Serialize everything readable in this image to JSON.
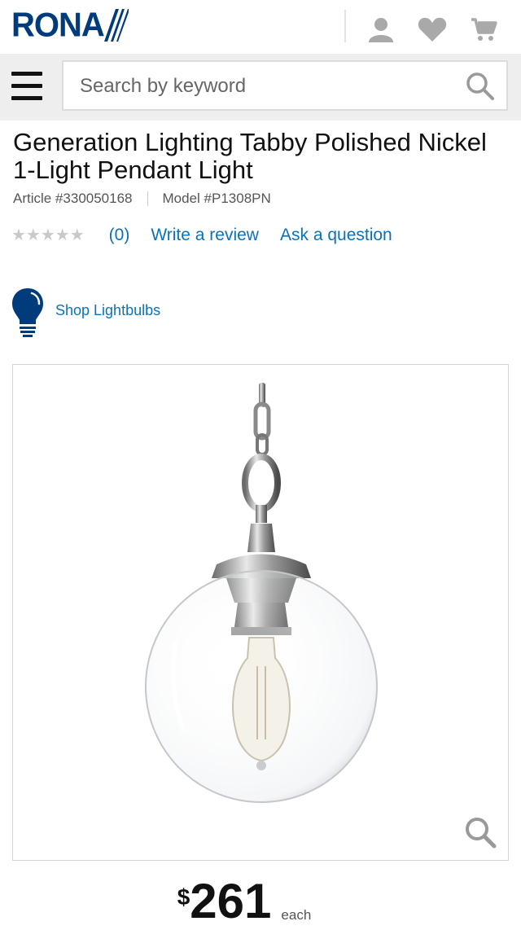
{
  "header": {
    "brand": "RONA",
    "brand_color": "#003b7c",
    "icons": [
      "account-icon",
      "wishlist-heart-icon",
      "cart-icon"
    ]
  },
  "search": {
    "placeholder": "Search by keyword",
    "value": ""
  },
  "product": {
    "title": "Generation Lighting Tabby Polished Nickel 1-Light Pendant Light",
    "article": "Article #330050168",
    "model": "Model #P1308PN",
    "rating_stars": 0,
    "review_count": "(0)",
    "write_review": "Write a review",
    "ask_question": "Ask a question",
    "shop_link": "Shop Lightbulbs",
    "price_currency": "$",
    "price_amount": "261",
    "price_unit": "each"
  },
  "colors": {
    "link": "#0b72b9",
    "stars_empty": "#c9c9c9"
  }
}
